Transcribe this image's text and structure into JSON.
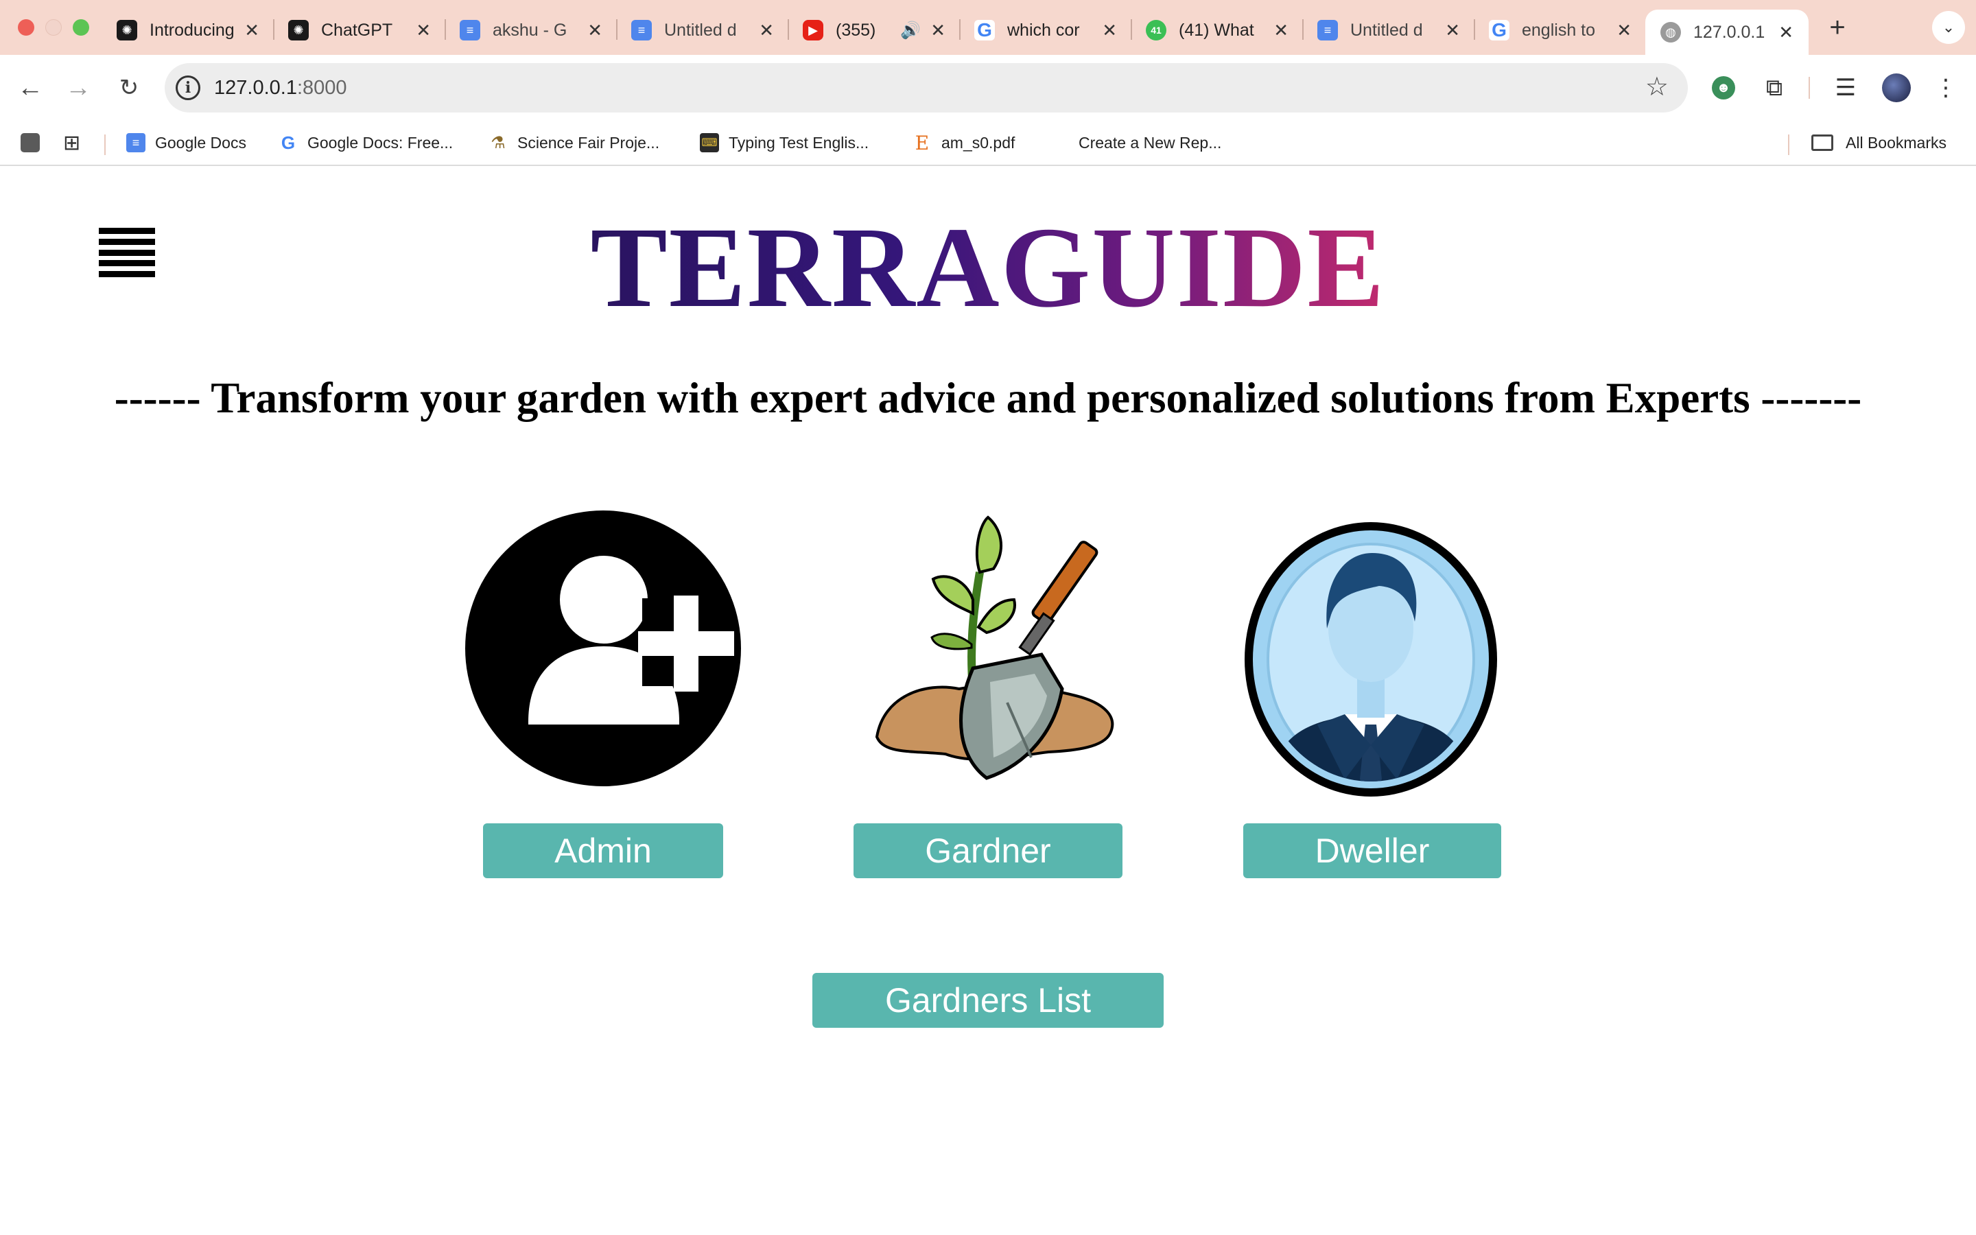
{
  "browser": {
    "tabs": [
      {
        "title": "Introducing",
        "icon": "chatgpt-icon"
      },
      {
        "title": "ChatGPT",
        "icon": "chatgpt-icon"
      },
      {
        "title": "akshu - G",
        "icon": "google-docs-icon"
      },
      {
        "title": "Untitled d",
        "icon": "google-docs-icon"
      },
      {
        "title": "(355)",
        "icon": "youtube-icon"
      },
      {
        "title": "which cor",
        "icon": "google-icon"
      },
      {
        "title": "(41) What",
        "icon": "whatsapp-icon"
      },
      {
        "title": "Untitled d",
        "icon": "google-docs-icon"
      },
      {
        "title": "english to",
        "icon": "google-icon"
      },
      {
        "title": "127.0.0.1",
        "icon": "globe-icon",
        "active": true
      }
    ],
    "new_tab": "+",
    "address": {
      "host": "127.0.0.1",
      "port": ":8000"
    },
    "bookmarks": [
      {
        "label": "Google Docs",
        "icon": "google-docs-icon"
      },
      {
        "label": "Google Docs: Free...",
        "icon": "google-icon"
      },
      {
        "label": "Science Fair Proje...",
        "icon": "science-icon"
      },
      {
        "label": "Typing Test Englis...",
        "icon": "typing-icon"
      },
      {
        "label": "am_s0.pdf",
        "icon": "pdf-icon"
      },
      {
        "label": "Create a New Rep...",
        "icon": "none"
      }
    ],
    "all_bookmarks": "All Bookmarks"
  },
  "site": {
    "logo": "TERRAGUIDE",
    "tagline": "------ Transform your garden with expert advice and personalized solutions from Experts -------",
    "roles": [
      {
        "label": "Admin",
        "icon": "add-user-icon"
      },
      {
        "label": "Gardner",
        "icon": "plant-shovel-icon"
      },
      {
        "label": "Dweller",
        "icon": "businessman-avatar-icon"
      }
    ],
    "gardeners_list": "Gardners List"
  },
  "colors": {
    "tabstrip": "#f6d8ce",
    "button": "#59b6ae",
    "logo_start": "#2a1460",
    "logo_end": "#c02a6e"
  }
}
